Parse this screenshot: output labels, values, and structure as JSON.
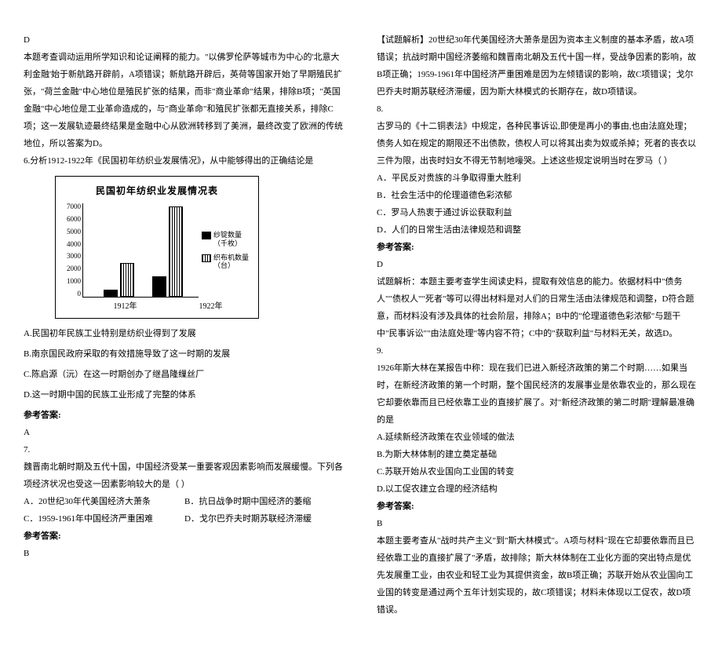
{
  "left": {
    "d": "D",
    "explain1": "本题考查调动运用所学知识和论证阐释的能力。\"以佛罗伦萨等城市为中心的'北意大利金融'始于新航路开辟前，A项错误；新航路开辟后，英荷等国家开始了早期殖民扩张，\"荷兰金融\"中心地位是殖民扩张的结果，而非\"商业革命\"结果，排除B项；\"英国金融\"中心地位是工业革命造成的，与\"商业革命\"和殖民扩张都无直接关系，排除C项；这一发展轨迹最终结果是金融中心从欧洲转移到了美洲，最终改变了欧洲的传统地位，所以答案为D。",
    "q6": "6.分析1912-1922年《民国初年纺织业发展情况》，从中能够得出的正确结论是",
    "q6a": "A.民国初年民族工业特别是纺织业得到了发展",
    "q6b": "B.南京国民政府采取的有效措施导致了这一时期的发展",
    "q6c": "C.陈启源（沅）在这一时期创办了继昌隆缫丝厂",
    "q6d": "D.这一时期中国的民族工业形成了完整的体系",
    "refLabel": "参考答案:",
    "q6ans": "A",
    "q7": "7.",
    "q7stem": "魏晋南北朝时期及五代十国，中国经济受某一重要客观因素影响而发展缓慢。下列各项经济状况也受这一因素影响较大的是（   ）",
    "q7a": "A．20世纪30年代美国经济大萧条",
    "q7b": "B．抗日战争时期中国经济的萎缩",
    "q7c": "C．1959-1961年中国经济严重困难",
    "q7d": "D．戈尔巴乔夫时期苏联经济滞缓",
    "q7ans": "B"
  },
  "right": {
    "explain7": "【试题解析】20世纪30年代美国经济大萧条是因为资本主义制度的基本矛盾，故A项错误；抗战时期中国经济萎缩和魏晋南北朝及五代十国一样，受战争因素的影响，故B项正确；1959-1961年中国经济严重困难是因为左倾错误的影响，故C项错误；戈尔巴乔夫时期苏联经济滞缓，因为斯大林模式的长期存在，故D项错误。",
    "q8": "8.",
    "q8stem": "古罗马的《十二铜表法》中规定，各种民事诉讼,即使是再小的事由,也由法庭处理；债务人如在规定的期限还不出债款，债权人可以将其出卖为奴或杀掉；死者的丧衣以三件为限，出丧时妇女不得无节制地嚎哭。上述这些规定说明当时在罗马（   ）",
    "q8a": "A．平民反对贵族的斗争取得重大胜利",
    "q8b": "B．社会生活中的伦理道德色彩浓郁",
    "q8c": "C．罗马人热衷于通过诉讼获取利益",
    "q8d": "D．人们的日常生活由法律规范和调整",
    "refLabel": "参考答案:",
    "q8ans": "D",
    "q8explain": "试题解析：本题主要考查学生阅读史料，提取有效信息的能力。依据材料中\"债务人\"\"债权人\"\"死者\"等可以得出材料是对人们的日常生活由法律规范和调整，D符合题意，而材料没有涉及具体的社会阶层，排除A；B中的\"伦理道德色彩浓郁\"与题干中\"民事诉讼\"\"由法庭处理\"等内容不符；C中的\"获取利益\"与材料无关，故选D。",
    "q9": "9.",
    "q9stem": "1926年斯大林在某报告中称：现在我们已进入新经济政策的第二个时期……如果当时，在新经济政策的第一个时期，整个国民经济的发展事业是依靠农业的，那么现在它却要依靠而且已经依靠工业的直接扩展了。对\"新经济政策的第二时期\"理解最准确的是",
    "q9a": "A.延续新经济政策在农业领域的做法",
    "q9b": "B.为斯大林体制的建立奠定基础",
    "q9c": "C.苏联开始从农业国向工业国的转变",
    "q9d": "D.以工促农建立合理的经济结构",
    "q9ans": "B",
    "q9explain": "本题主要考查从\"战时共产主义\"到\"斯大林模式\"。A项与材料\"现在它却要依靠而且已经依靠工业的直接扩展了\"矛盾，故排除；斯大林体制在工业化方面的突出特点是优先发展重工业，由农业和轻工业为其提供资金，故B项正确；苏联开始从农业国向工业国的转变是通过两个五年计划实现的，故C项错误；材料未体现以工促农，故D项错误。"
  },
  "chart_data": {
    "type": "bar",
    "title": "民国初年纺织业发展情况表",
    "categories": [
      "1912年",
      "1922年"
    ],
    "series": [
      {
        "name": "纱锭数量（千枚）",
        "values": [
          500,
          1500
        ]
      },
      {
        "name": "织布机数量（台）",
        "values": [
          2500,
          6700
        ]
      }
    ],
    "ylim": [
      0,
      7000
    ],
    "yticks": [
      7000,
      6000,
      5000,
      4000,
      3000,
      2000,
      1000,
      0
    ]
  }
}
